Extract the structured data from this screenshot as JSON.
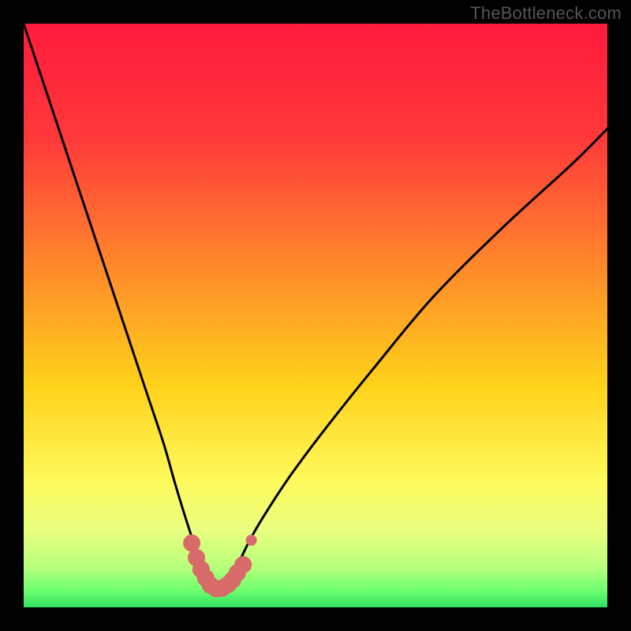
{
  "watermark": "TheBottleneck.com",
  "chart_data": {
    "type": "line",
    "title": "",
    "xlabel": "",
    "ylabel": "",
    "xlim": [
      0,
      100
    ],
    "ylim": [
      0,
      100
    ],
    "gradient_stops": [
      {
        "offset": 0,
        "color": "#ff1a3c"
      },
      {
        "offset": 20,
        "color": "#ff3a3a"
      },
      {
        "offset": 42,
        "color": "#ff8a2a"
      },
      {
        "offset": 62,
        "color": "#ffd21a"
      },
      {
        "offset": 78,
        "color": "#fff95a"
      },
      {
        "offset": 87,
        "color": "#e8ff80"
      },
      {
        "offset": 93,
        "color": "#b8ff7a"
      },
      {
        "offset": 97,
        "color": "#70ff70"
      },
      {
        "offset": 100,
        "color": "#30e060"
      }
    ],
    "curve": {
      "description": "V-shaped bottleneck curve with minimum near x≈33",
      "x": [
        0,
        3,
        6,
        9,
        12,
        15,
        18,
        21,
        24,
        26,
        28,
        30,
        31,
        32,
        33,
        34,
        35,
        37,
        39,
        42,
        46,
        52,
        60,
        70,
        82,
        94,
        100
      ],
      "y": [
        100,
        91,
        82,
        73,
        64,
        55,
        46,
        37,
        28,
        21,
        14.5,
        8.5,
        5.5,
        3.5,
        2.8,
        3.2,
        4.6,
        8,
        12,
        17,
        23,
        31,
        41,
        53,
        65,
        76,
        82
      ]
    },
    "markers": {
      "color": "#d86a6a",
      "x": [
        28.8,
        29.6,
        30.4,
        31.2,
        32.0,
        33.0,
        34.0,
        35.0,
        35.8,
        36.6,
        37.6,
        39.0
      ],
      "y": [
        11.0,
        8.5,
        6.5,
        5.0,
        3.8,
        3.2,
        3.3,
        3.9,
        4.7,
        5.9,
        7.3,
        11.5
      ],
      "radius": [
        11,
        11,
        11,
        11,
        11,
        11,
        11,
        11,
        11,
        11,
        11,
        7
      ]
    }
  }
}
